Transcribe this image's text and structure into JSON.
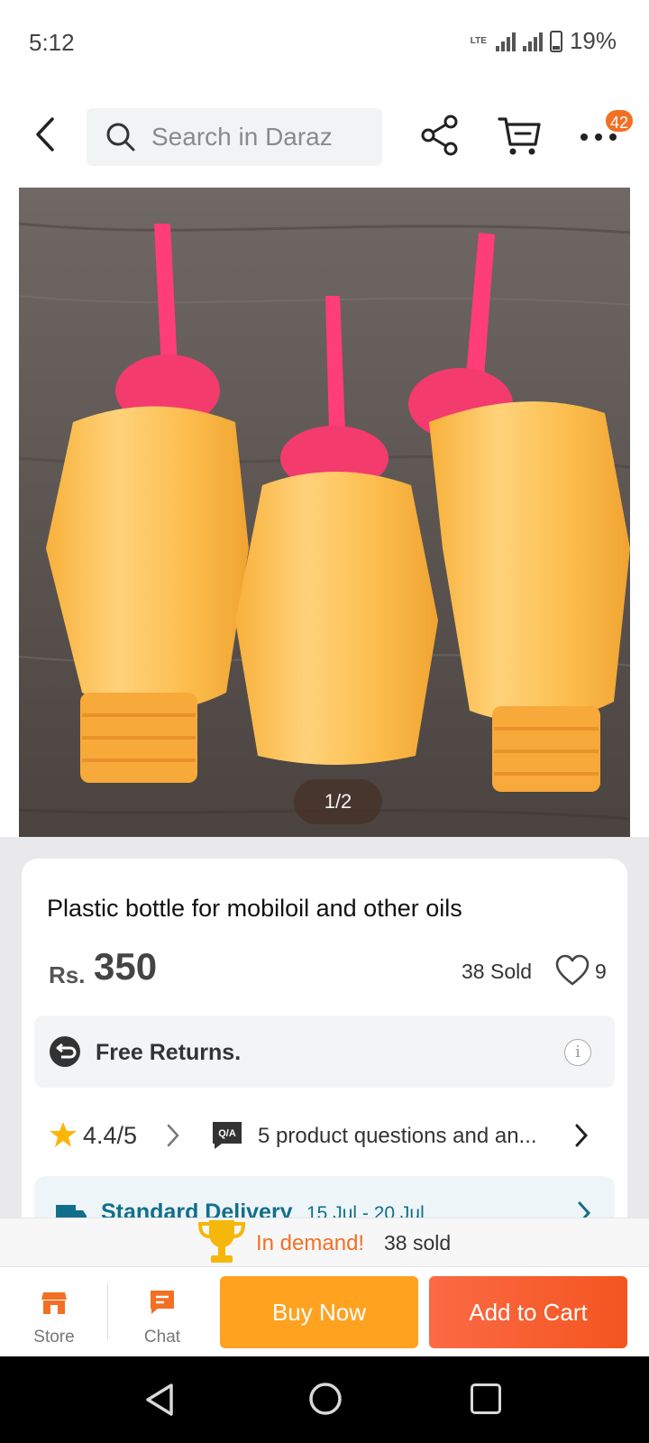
{
  "status_bar": {
    "time": "5:12",
    "network": "LTE",
    "battery": "19%"
  },
  "header": {
    "search_placeholder": "Search in Daraz",
    "cart_badge": "42"
  },
  "gallery": {
    "counter": "1/2"
  },
  "product": {
    "title": "Plastic bottle for mobiloil and other oils",
    "currency": "Rs.",
    "price": "350",
    "sold": "38 Sold",
    "likes": "9",
    "returns_label": "Free Returns.",
    "rating": "4.4/5",
    "qa_icon_label": "Q/A",
    "qa_text": "5 product questions and an...",
    "delivery_label": "Standard Delivery",
    "delivery_date": "15 Jul - 20 Jul"
  },
  "demand": {
    "label": "In demand!",
    "count": "38 sold"
  },
  "action_bar": {
    "store_label": "Store",
    "chat_label": "Chat",
    "buy_now": "Buy Now",
    "add_to_cart": "Add to Cart"
  },
  "colors": {
    "brand_orange": "#f36f24",
    "buy_now": "#fea220",
    "add_to_cart": "#f4551f",
    "delivery_teal": "#126f8c"
  },
  "icons": [
    "back-arrow-icon",
    "search-icon",
    "share-icon",
    "cart-icon",
    "more-icon",
    "heart-icon",
    "returns-icon",
    "info-icon",
    "star-icon",
    "qa-icon",
    "truck-icon",
    "trophy-icon",
    "store-icon",
    "chat-icon"
  ]
}
